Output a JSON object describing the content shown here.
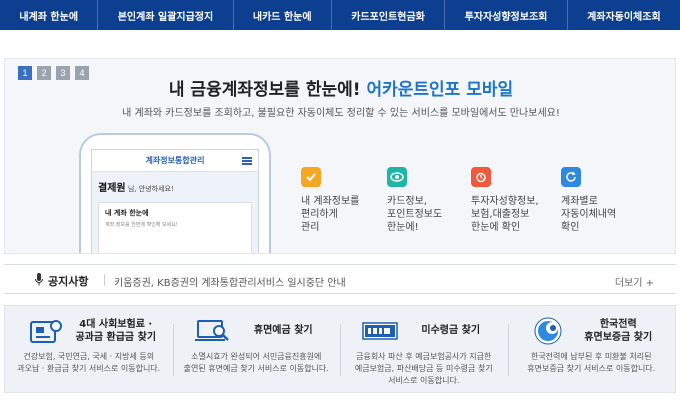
{
  "nav": {
    "items": [
      "내계좌 한눈에",
      "본인계좌 일괄지급정지",
      "내카드 한눈에",
      "카드포인트현금화",
      "투자자성향정보조회",
      "계좌자동이체조회"
    ]
  },
  "banner": {
    "pages": [
      "1",
      "2",
      "3",
      "4"
    ],
    "active_page": "1",
    "headline_main": "내 금융계좌정보를 한눈에!",
    "headline_accent": "어카운트인포 모바일",
    "subline": "내 계좌와 카드정보를 조회하고, 불필요한 자동이체도 정리할 수 있는 서비스를 모바일에서도 만나보세요!",
    "phone": {
      "app_title": "계좌정보통합관리",
      "user_name": "결제원",
      "greeting": "님, 안녕하세요!",
      "card_title": "내 계좌 한눈에",
      "card_desc": "계좌 정보를 한번에 확인해 보세요!"
    },
    "features": [
      {
        "icon": "check-icon",
        "color": "#f5a623",
        "lines": [
          "내 계좌정보를",
          "편리하게",
          "관리"
        ]
      },
      {
        "icon": "eye-icon",
        "color": "#1fb5a5",
        "lines": [
          "카드정보,",
          "포인트정보도",
          "한눈에!"
        ]
      },
      {
        "icon": "alarm-icon",
        "color": "#f05a3c",
        "lines": [
          "투자자성향정보,",
          "보험,대출정보",
          "한눈에 확인"
        ]
      },
      {
        "icon": "refresh-icon",
        "color": "#2d8ae0",
        "lines": [
          "계좌별로",
          "자동이체내역",
          "확인"
        ]
      }
    ]
  },
  "notice": {
    "label": "공지사항",
    "text": "키움증권, KB증권의 계좌통합관리서비스 일시중단 안내",
    "more": "더보기 +"
  },
  "services": [
    {
      "icon": "insurance-refund-icon",
      "title_lines": [
        "4대 사회보험료 ·",
        "공과금 환급금 찾기"
      ],
      "desc_lines": [
        "건강보험, 국민연금, 국세 · 지방세 등의",
        "과오납 · 환급금 찾기 서비스로 이동합니다."
      ]
    },
    {
      "icon": "dormant-deposit-icon",
      "title_lines": [
        "휴면예금 찾기"
      ],
      "desc_lines": [
        "소멸시효가 완성되어 서민금융진흥원에",
        "출연된 휴면예금 찾기 서비스로 이동합니다."
      ]
    },
    {
      "icon": "kdic-logo-icon",
      "title_lines": [
        "미수령금 찾기"
      ],
      "desc_lines": [
        "금융회사 파산 후 예금보험공사가 지급한",
        "예금보험금, 파산배당금 등 미수령금 찾기",
        "서비스로 이동합니다."
      ]
    },
    {
      "icon": "kepco-logo-icon",
      "title_lines": [
        "한국전력",
        "휴면보증금 찾기"
      ],
      "desc_lines": [
        "한국전력에 납부된 후 미환불 처리된",
        "휴면보증금 찾기 서비스로 이동합니다."
      ]
    }
  ]
}
